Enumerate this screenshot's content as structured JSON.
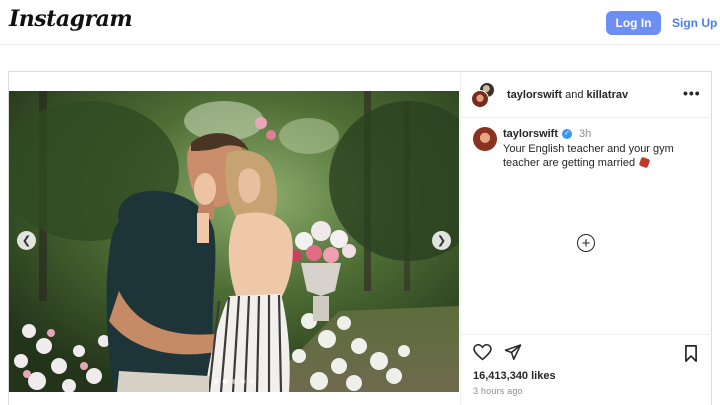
{
  "header": {
    "logo_text": "Instagram",
    "login_label": "Log In",
    "signup_label": "Sign Up"
  },
  "post": {
    "collab": {
      "user1": "taylorswift",
      "joiner": "and",
      "user2": "killatrav"
    },
    "caption": {
      "username": "taylorswift",
      "time": "3h",
      "text": "Your English teacher and your gym teacher are getting married"
    },
    "media": {
      "carousel_count": 5,
      "active_index": 1
    },
    "likes_text": "16,413,340 likes",
    "posted_ago": "3 hours ago"
  },
  "colors": {
    "login_button": "#6c8ef5",
    "signup_link": "#4a7ff3",
    "verified_badge": "#3897f0"
  },
  "icons": {
    "more": "more-options-icon",
    "add_comment": "plus-circle-icon",
    "like": "heart-icon",
    "share": "send-icon",
    "save": "bookmark-icon",
    "prev": "chevron-left-icon",
    "next": "chevron-right-icon",
    "verified": "verified-badge-icon"
  }
}
